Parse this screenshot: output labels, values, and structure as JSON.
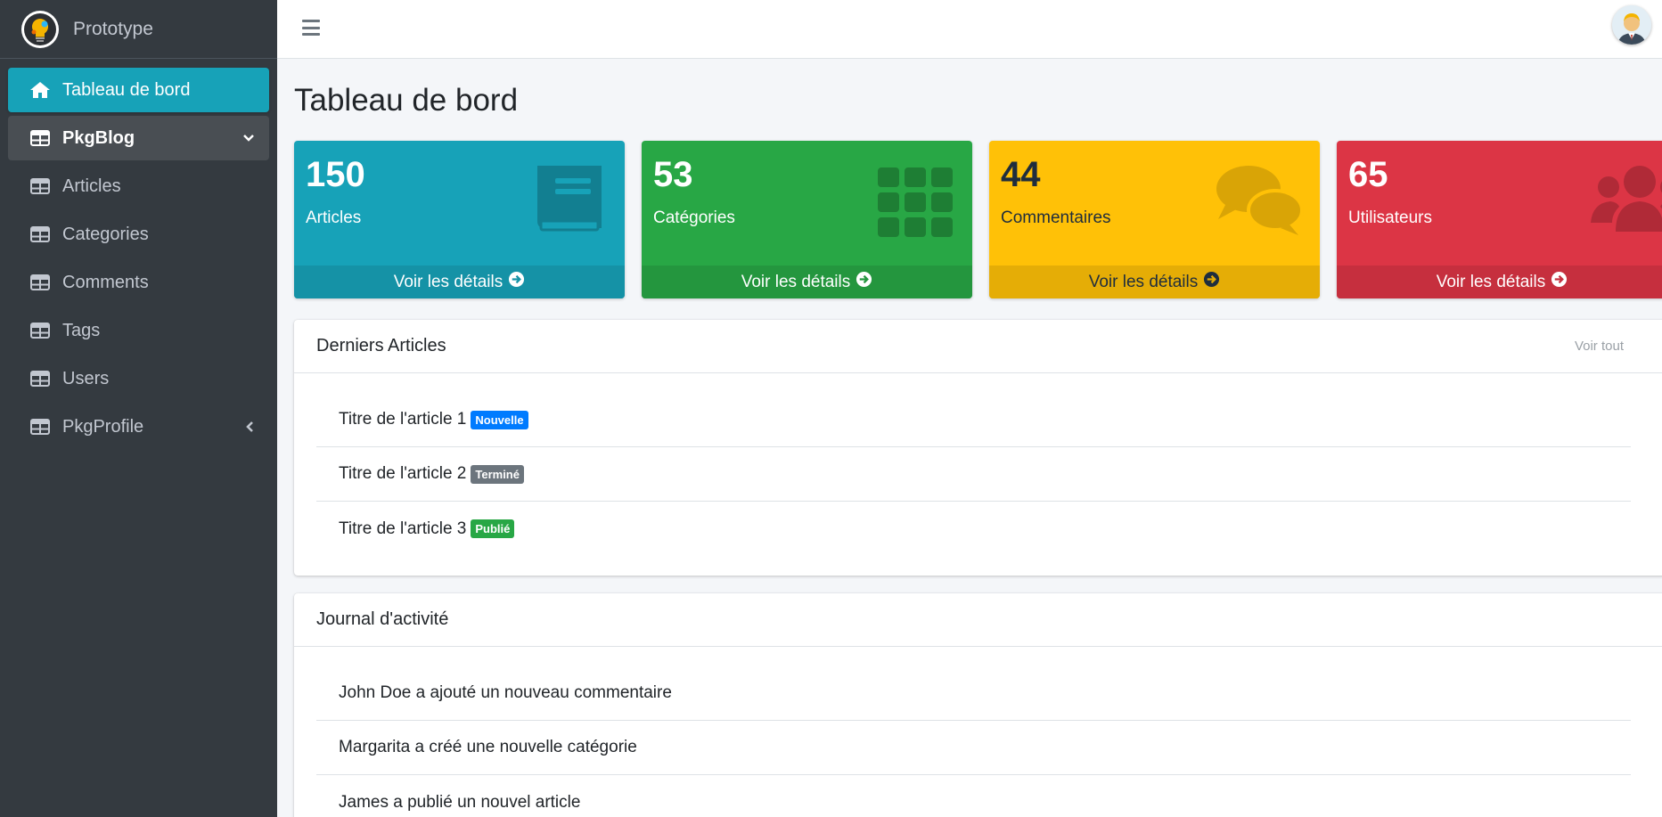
{
  "brand": {
    "name": "Prototype",
    "logo_icon": "lightbulb-gear-logo"
  },
  "sidebar": {
    "items": [
      {
        "label": "Tableau de bord",
        "icon": "home-icon",
        "state": "active"
      },
      {
        "label": "PkgBlog",
        "icon": "table-icon",
        "state": "open",
        "arrow": "chevron-down-icon"
      },
      {
        "label": "Articles",
        "icon": "table-icon"
      },
      {
        "label": "Categories",
        "icon": "table-icon"
      },
      {
        "label": "Comments",
        "icon": "table-icon"
      },
      {
        "label": "Tags",
        "icon": "table-icon"
      },
      {
        "label": "Users",
        "icon": "table-icon"
      },
      {
        "label": "PkgProfile",
        "icon": "table-icon",
        "arrow": "chevron-left-icon"
      }
    ]
  },
  "topbar": {
    "menu_icon": "hamburger-icon",
    "avatar_icon": "user-avatar"
  },
  "page": {
    "title": "Tableau de bord"
  },
  "stats": [
    {
      "value": "150",
      "label": "Articles",
      "footer": "Voir les détails",
      "icon": "book-icon",
      "color": "#17a2b8"
    },
    {
      "value": "53",
      "label": "Catégories",
      "footer": "Voir les détails",
      "icon": "grid-icon",
      "color": "#28a745"
    },
    {
      "value": "44",
      "label": "Commentaires",
      "footer": "Voir les détails",
      "icon": "comments-icon",
      "color": "#ffc107"
    },
    {
      "value": "65",
      "label": "Utilisateurs",
      "footer": "Voir les détails",
      "icon": "users-icon",
      "color": "#dc3545"
    }
  ],
  "latest_articles": {
    "title": "Derniers Articles",
    "tool": "Voir tout",
    "items": [
      {
        "text": "Titre de l'article 1",
        "badge": "Nouvelle",
        "badge_color": "#007bff"
      },
      {
        "text": "Titre de l'article 2",
        "badge": "Terminé",
        "badge_color": "#6c757d"
      },
      {
        "text": "Titre de l'article 3",
        "badge": "Publié",
        "badge_color": "#28a745"
      }
    ]
  },
  "activity_log": {
    "title": "Journal d'activité",
    "items": [
      {
        "text": "John Doe a ajouté un nouveau commentaire"
      },
      {
        "text": "Margarita a créé une nouvelle catégorie"
      },
      {
        "text": "James a publié un nouvel article"
      }
    ]
  }
}
